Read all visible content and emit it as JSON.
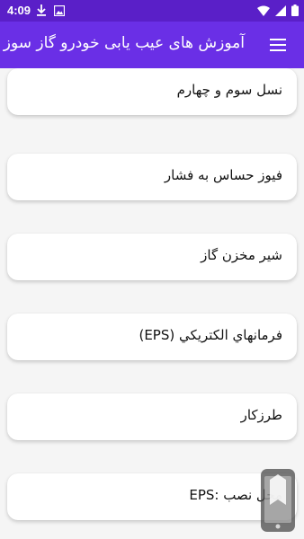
{
  "status_bar": {
    "time": "4:09",
    "left_icons": [
      "download-icon",
      "image-icon"
    ],
    "right_icons": [
      "wifi-icon",
      "signal-icon",
      "battery-icon"
    ]
  },
  "app_bar": {
    "title": "آموزش های عیب یابی خودرو گاز سوز",
    "menu_icon": "hamburger-menu-icon"
  },
  "items": [
    {
      "label": "نسل سوم و چهارم"
    },
    {
      "label": "فیوز حساس به فشار"
    },
    {
      "label": "شیر مخزن گاز"
    },
    {
      "label": "فرمانهاي الكتريكي (EPS)"
    },
    {
      "label": "طرزکار"
    },
    {
      "label": "محل نصب  :EPS"
    }
  ],
  "fab": {
    "icon": "mobile-app-icon"
  },
  "colors": {
    "status_bar": "#5a1fc8",
    "app_bar": "#6a2fe6",
    "background": "#f5f5f5",
    "card": "#ffffff"
  }
}
